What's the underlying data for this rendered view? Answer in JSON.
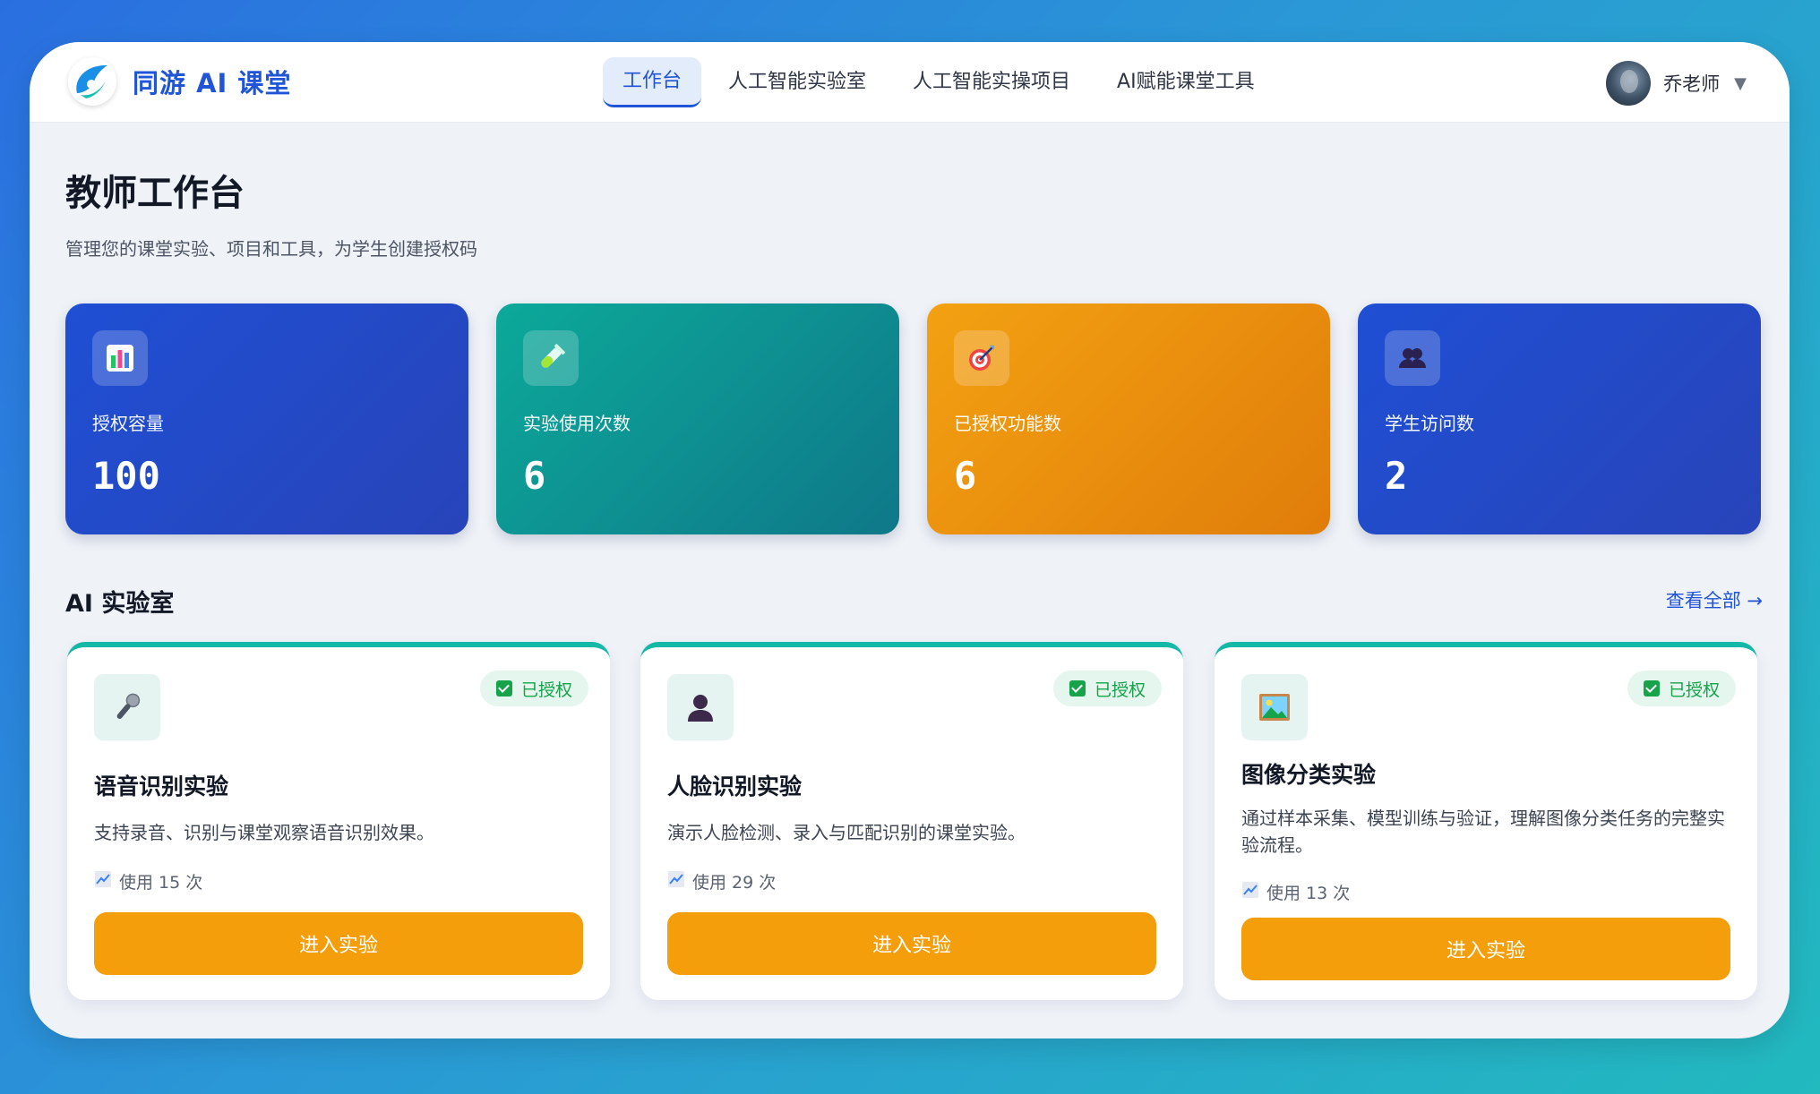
{
  "app": {
    "brand_name": "同游 AI 课堂"
  },
  "nav": {
    "items": [
      {
        "label": "工作台",
        "active": true
      },
      {
        "label": "人工智能实验室",
        "active": false
      },
      {
        "label": "人工智能实操项目",
        "active": false
      },
      {
        "label": "AI赋能课堂工具",
        "active": false
      }
    ]
  },
  "user": {
    "name": "乔老师",
    "caret": "▼"
  },
  "page": {
    "title": "教师工作台",
    "subtitle": "管理您的课堂实验、项目和工具，为学生创建授权码"
  },
  "stats": [
    {
      "label": "授权容量",
      "value": "100",
      "icon": "bar-chart-icon"
    },
    {
      "label": "实验使用次数",
      "value": "6",
      "icon": "test-tube-icon"
    },
    {
      "label": "已授权功能数",
      "value": "6",
      "icon": "target-icon"
    },
    {
      "label": "学生访问数",
      "value": "2",
      "icon": "users-icon"
    }
  ],
  "lab_section": {
    "title": "AI 实验室",
    "view_all": "查看全部 →"
  },
  "labs": [
    {
      "title": "语音识别实验",
      "desc": "支持录音、识别与课堂观察语音识别效果。",
      "usage": "使用 15 次",
      "badge": "已授权",
      "button": "进入实验",
      "icon": "microphone-icon"
    },
    {
      "title": "人脸识别实验",
      "desc": "演示人脸检测、录入与匹配识别的课堂实验。",
      "usage": "使用 29 次",
      "badge": "已授权",
      "button": "进入实验",
      "icon": "person-icon"
    },
    {
      "title": "图像分类实验",
      "desc": "通过样本采集、模型训练与验证，理解图像分类任务的完整实验流程。",
      "usage": "使用 13 次",
      "badge": "已授权",
      "button": "进入实验",
      "icon": "picture-icon"
    }
  ],
  "colors": {
    "primary": "#1f55d6",
    "accent_orange": "#f59e0b",
    "teal": "#14b8a6",
    "success": "#16a34a"
  }
}
